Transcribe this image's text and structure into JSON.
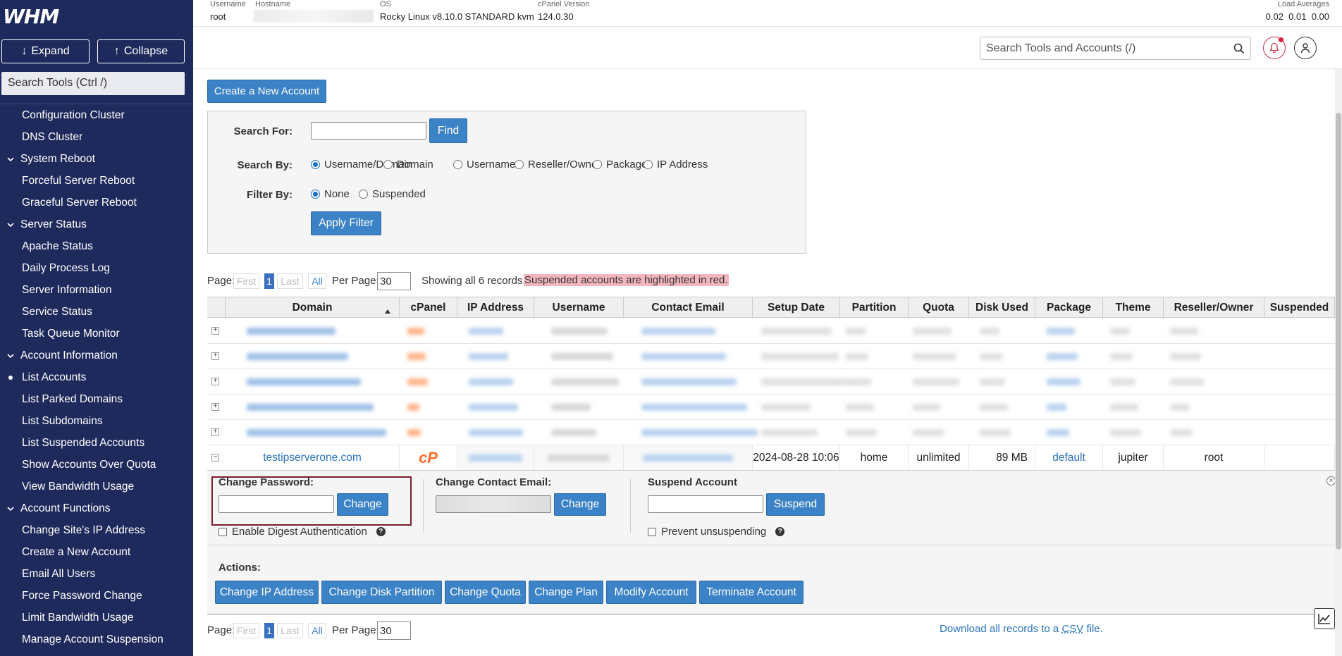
{
  "sidebar": {
    "logo": "WHM",
    "expand_label": "Expand",
    "collapse_label": "Collapse",
    "search_placeholder": "Search Tools (Ctrl /)",
    "items": [
      {
        "label": "Configuration Cluster",
        "type": "item"
      },
      {
        "label": "DNS Cluster",
        "type": "item"
      },
      {
        "label": "System Reboot",
        "type": "group"
      },
      {
        "label": "Forceful Server Reboot",
        "type": "item"
      },
      {
        "label": "Graceful Server Reboot",
        "type": "item"
      },
      {
        "label": "Server Status",
        "type": "group"
      },
      {
        "label": "Apache Status",
        "type": "item"
      },
      {
        "label": "Daily Process Log",
        "type": "item"
      },
      {
        "label": "Server Information",
        "type": "item"
      },
      {
        "label": "Service Status",
        "type": "item"
      },
      {
        "label": "Task Queue Monitor",
        "type": "item"
      },
      {
        "label": "Account Information",
        "type": "group"
      },
      {
        "label": "List Accounts",
        "type": "item",
        "active": true
      },
      {
        "label": "List Parked Domains",
        "type": "item"
      },
      {
        "label": "List Subdomains",
        "type": "item"
      },
      {
        "label": "List Suspended Accounts",
        "type": "item"
      },
      {
        "label": "Show Accounts Over Quota",
        "type": "item"
      },
      {
        "label": "View Bandwidth Usage",
        "type": "item"
      },
      {
        "label": "Account Functions",
        "type": "group"
      },
      {
        "label": "Change Site's IP Address",
        "type": "item"
      },
      {
        "label": "Create a New Account",
        "type": "item"
      },
      {
        "label": "Email All Users",
        "type": "item"
      },
      {
        "label": "Force Password Change",
        "type": "item"
      },
      {
        "label": "Limit Bandwidth Usage",
        "type": "item"
      },
      {
        "label": "Manage Account Suspension",
        "type": "item"
      }
    ]
  },
  "topinfo": {
    "username_label": "Username",
    "username": "root",
    "hostname_label": "Hostname",
    "os_label": "OS",
    "os": "Rocky Linux v8.10.0 STANDARD kvm",
    "cpanel_label": "cPanel Version",
    "cpanel_version": "124.0.30",
    "load_label": "Load Averages",
    "load": "0.02  0.01  0.00"
  },
  "header": {
    "search_placeholder": "Search Tools and Accounts (/)"
  },
  "create_button": "Create a New Account",
  "search": {
    "search_for_label": "Search For:",
    "find_button": "Find",
    "search_by_label": "Search By:",
    "search_by_options": [
      "Username/Domain",
      "Domain",
      "Username",
      "Reseller/Owner",
      "Package",
      "IP Address"
    ],
    "filter_by_label": "Filter By:",
    "filter_options": [
      "None",
      "Suspended"
    ],
    "apply_button": "Apply Filter"
  },
  "pager": {
    "page_label": "Page:",
    "first": "First",
    "current": "1",
    "last": "Last",
    "all": "All",
    "per_page_label": "Per Page:",
    "per_page": "30",
    "showing": "Showing all 6 records.",
    "suspended_note": "Suspended accounts are highlighted in red."
  },
  "table": {
    "columns": [
      "Domain",
      "cPanel",
      "IP Address",
      "Username",
      "Contact Email",
      "Setup Date",
      "Partition",
      "Quota",
      "Disk Used",
      "Package",
      "Theme",
      "Reseller/Owner",
      "Suspended"
    ],
    "visible_row": {
      "domain": "testipserverone.com",
      "cpanel_icon": "cP",
      "setup_date": "2024-08-28 10:06",
      "partition": "home",
      "quota": "unlimited",
      "disk_used": "89 MB",
      "package": "default",
      "theme": "jupiter",
      "owner": "root"
    }
  },
  "detail": {
    "change_password_title": "Change Password:",
    "change_button": "Change",
    "digest_label": "Enable Digest Authentication",
    "contact_email_title": "Change Contact Email:",
    "contact_change_button": "Change",
    "suspend_title": "Suspend Account",
    "suspend_button": "Suspend",
    "prevent_label": "Prevent unsuspending",
    "actions_label": "Actions:",
    "actions": [
      "Change IP Address",
      "Change Disk Partition",
      "Change Quota",
      "Change Plan",
      "Modify Account",
      "Terminate Account"
    ]
  },
  "footer": {
    "download_prefix": "Download all records to a",
    "download_csv": "CSV",
    "download_suffix": "file."
  },
  "colors": {
    "sidebar_bg": "#1f2a5c",
    "primary": "#3b83c6",
    "suspended_highlight": "#f4b6be",
    "cpanel_orange": "#ff6c2c"
  }
}
